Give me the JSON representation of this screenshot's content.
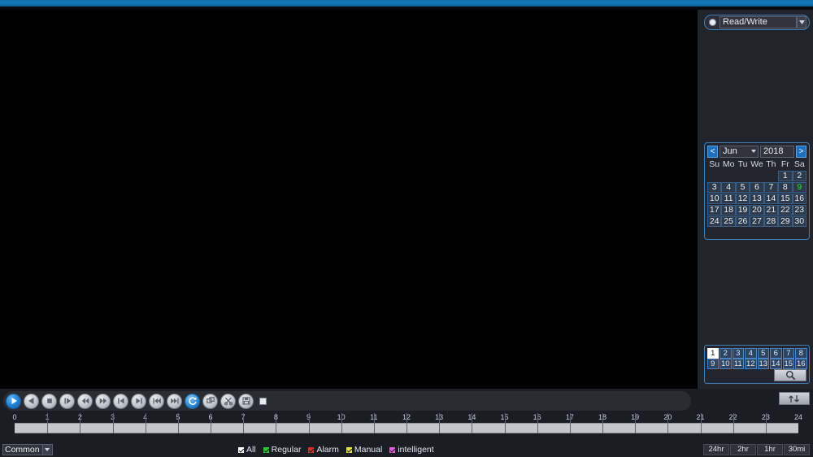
{
  "window": {
    "title": ""
  },
  "right_panel": {
    "mode": {
      "label": "Read/Write",
      "dot": "radio-dot",
      "arrow_icon": "chevron-down-icon"
    },
    "calendar": {
      "prev_label": "<",
      "next_label": ">",
      "month": "Jun",
      "year": "2018",
      "dow": [
        "Su",
        "Mo",
        "Tu",
        "We",
        "Th",
        "Fr",
        "Sa"
      ],
      "weeks": [
        [
          "",
          "",
          "",
          "",
          "",
          "1",
          "2"
        ],
        [
          "3",
          "4",
          "5",
          "6",
          "7",
          "8",
          "9"
        ],
        [
          "10",
          "11",
          "12",
          "13",
          "14",
          "15",
          "16"
        ],
        [
          "17",
          "18",
          "19",
          "20",
          "21",
          "22",
          "23"
        ],
        [
          "24",
          "25",
          "26",
          "27",
          "28",
          "29",
          "30"
        ]
      ],
      "highlighted_day": "9",
      "highlight_color": "#2ee02e"
    },
    "channels": {
      "row1": [
        "1",
        "2",
        "3",
        "4",
        "5",
        "6",
        "7",
        "8"
      ],
      "row2": [
        "9",
        "10",
        "11",
        "12",
        "13",
        "14",
        "15",
        "16"
      ],
      "selected": "1",
      "search_icon": "magnifier-icon"
    }
  },
  "controls": {
    "buttons": [
      {
        "name": "play-button",
        "icon": "play-icon",
        "style": "primary"
      },
      {
        "name": "reverse-play-button",
        "icon": "play-reverse-icon",
        "style": "normal"
      },
      {
        "name": "stop-button",
        "icon": "stop-icon",
        "style": "normal"
      },
      {
        "name": "slow-play-button",
        "icon": "slow-play-icon",
        "style": "normal"
      },
      {
        "name": "rewind-button",
        "icon": "rewind-icon",
        "style": "normal"
      },
      {
        "name": "fast-forward-button",
        "icon": "fast-forward-icon",
        "style": "normal"
      },
      {
        "name": "previous-frame-button",
        "icon": "skip-back-icon",
        "style": "normal"
      },
      {
        "name": "next-frame-button",
        "icon": "skip-forward-icon",
        "style": "normal"
      },
      {
        "name": "previous-file-button",
        "icon": "prev-file-icon",
        "style": "normal"
      },
      {
        "name": "next-file-button",
        "icon": "next-file-icon",
        "style": "normal"
      },
      {
        "name": "sync-playback-button",
        "icon": "loop-sync-icon",
        "style": "accent"
      },
      {
        "name": "multi-window-button",
        "icon": "windows-icon",
        "style": "normal"
      },
      {
        "name": "clip-button",
        "icon": "scissors-icon",
        "style": "normal"
      },
      {
        "name": "backup-button",
        "icon": "save-disk-icon",
        "style": "normal"
      }
    ],
    "record_stop": {
      "name": "record-stop-square",
      "icon": "square-icon"
    },
    "sync_toggle": {
      "name": "sync-toggle-button",
      "icon": "two-arrows-icon"
    }
  },
  "timeline": {
    "ticks": [
      "0",
      "1",
      "2",
      "3",
      "4",
      "5",
      "6",
      "7",
      "8",
      "9",
      "10",
      "11",
      "12",
      "13",
      "14",
      "15",
      "16",
      "17",
      "18",
      "19",
      "20",
      "21",
      "22",
      "23",
      "24"
    ],
    "range_start": 0,
    "range_end": 24,
    "track_color": "#c3c6cb",
    "segments": []
  },
  "statusbar": {
    "common_select": {
      "value": "Common I",
      "arrow_icon": "chevron-down-icon"
    },
    "legend": [
      {
        "label": "All",
        "color": "#ffffff",
        "checked": true
      },
      {
        "label": "Regular",
        "color": "#2fc72f",
        "checked": true
      },
      {
        "label": "Alarm",
        "color": "#e02a2a",
        "checked": true
      },
      {
        "label": "Manual",
        "color": "#e8e244",
        "checked": true
      },
      {
        "label": "intelligent",
        "color": "#e05fd8",
        "checked": true
      }
    ],
    "scale_buttons": [
      "24hr",
      "2hr",
      "1hr",
      "30mi"
    ]
  }
}
